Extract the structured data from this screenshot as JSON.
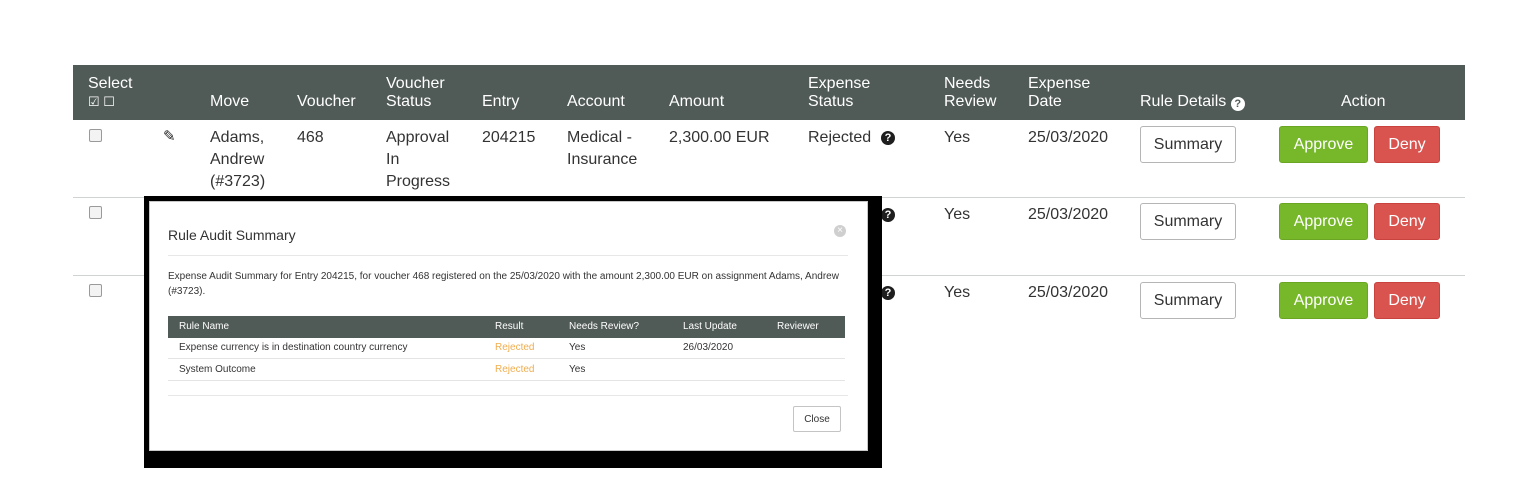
{
  "table": {
    "headers": {
      "select": "Select",
      "move": "Move",
      "voucher": "Voucher",
      "voucher_status_1": "Voucher",
      "voucher_status_2": "Status",
      "entry": "Entry",
      "account": "Account",
      "amount": "Amount",
      "expense_status_1": "Expense",
      "expense_status_2": "Status",
      "needs_review_1": "Needs",
      "needs_review_2": "Review",
      "expense_date_1": "Expense",
      "expense_date_2": "Date",
      "rule_details": "Rule Details",
      "action": "Action"
    },
    "rows": [
      {
        "move_1": "Adams,",
        "move_2": "Andrew",
        "move_3": "(#3723)",
        "voucher": "468",
        "status_1": "Approval",
        "status_2": "In",
        "status_3": "Progress",
        "entry": "204215",
        "account_1": "Medical -",
        "account_2": "Insurance",
        "amount": "2,300.00 EUR",
        "expense_status": "Rejected",
        "needs_review": "Yes",
        "expense_date": "25/03/2020",
        "summary": "Summary",
        "approve": "Approve",
        "deny": "Deny"
      },
      {
        "needs_review": "Yes",
        "expense_date": "25/03/2020",
        "summary": "Summary",
        "approve": "Approve",
        "deny": "Deny"
      },
      {
        "needs_review": "Yes",
        "expense_date": "25/03/2020",
        "summary": "Summary",
        "approve": "Approve",
        "deny": "Deny"
      }
    ]
  },
  "modal": {
    "title": "Rule Audit Summary",
    "description": "Expense Audit Summary for Entry 204215, for voucher 468 registered on the 25/03/2020 with the amount 2,300.00 EUR on assignment Adams, Andrew (#3723).",
    "columns": [
      "Rule Name",
      "Result",
      "Needs Review?",
      "Last Update",
      "Reviewer"
    ],
    "rows": [
      [
        "Expense currency is in destination country currency",
        "Rejected",
        "Yes",
        "26/03/2020",
        ""
      ],
      [
        "System Outcome",
        "Rejected",
        "Yes",
        "",
        ""
      ]
    ],
    "close_label": "Close"
  },
  "colors": {
    "header_bg": "#505a57",
    "approve": "#77b72a",
    "deny": "#d9534f",
    "rejected_text": "#f0ad4e"
  },
  "icons": [
    "check-square-icon",
    "square-icon",
    "pencil-icon",
    "question-circle-icon",
    "close-circle-icon"
  ]
}
